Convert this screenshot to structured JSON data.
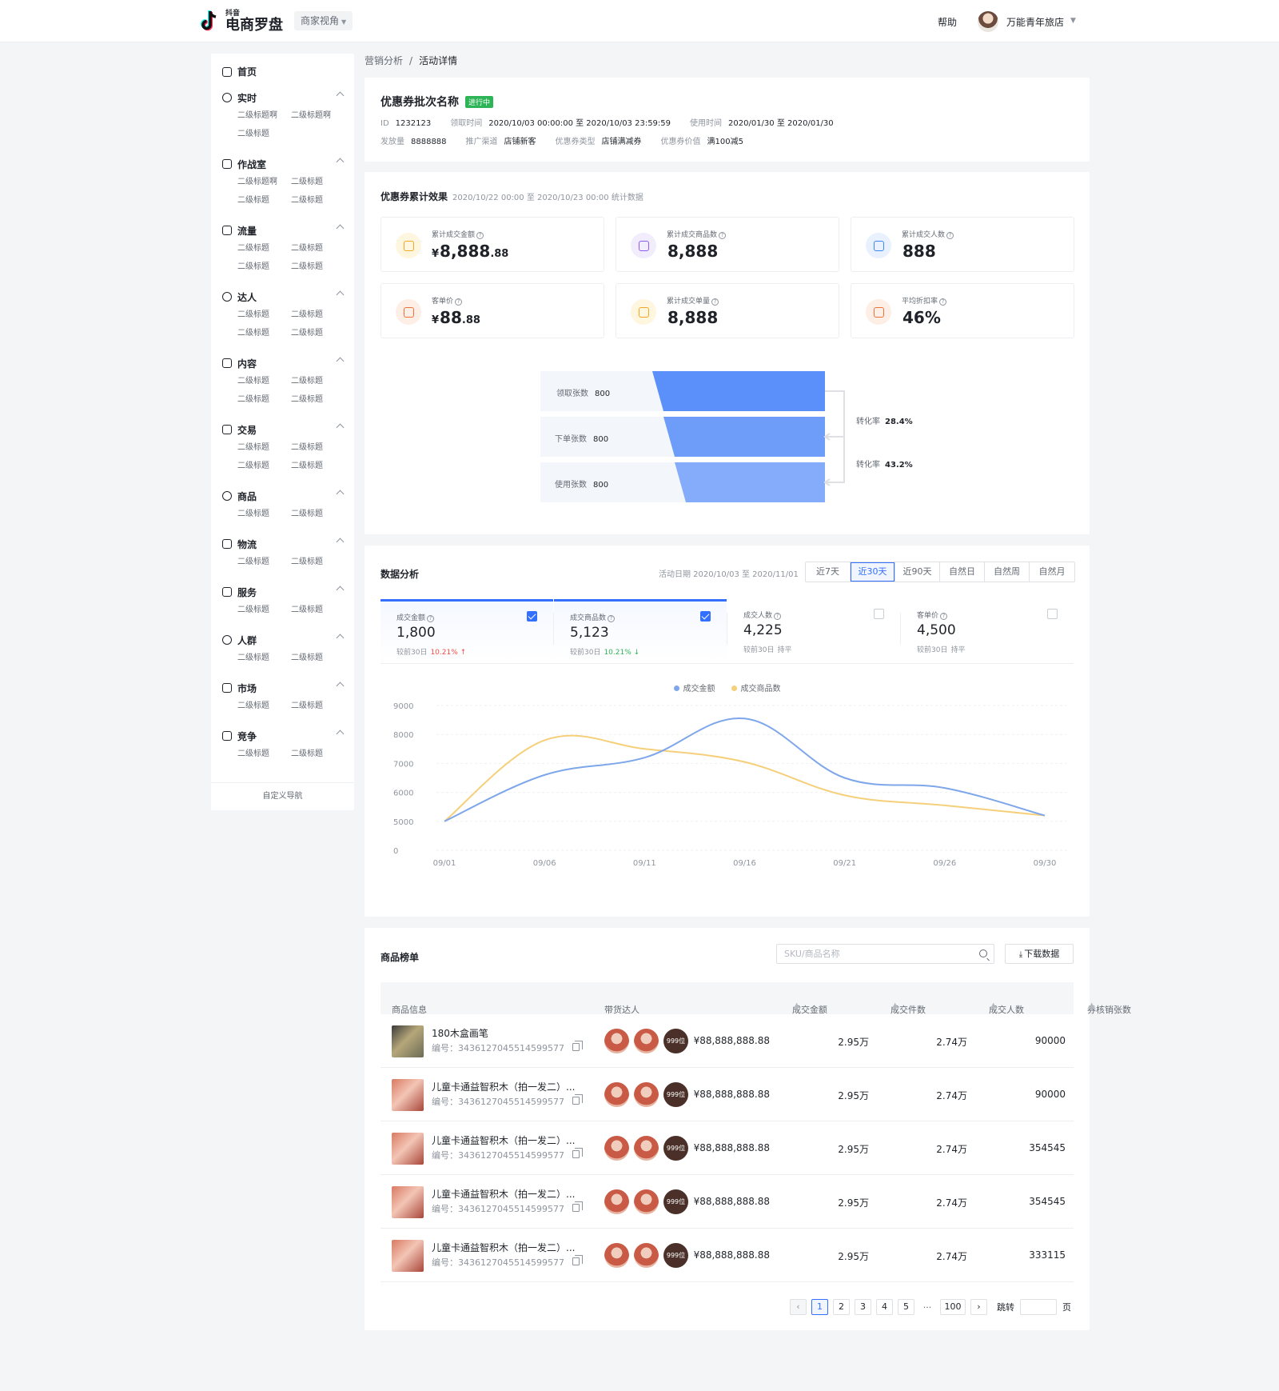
{
  "header": {
    "logo_small": "抖音",
    "logo_big": "电商罗盘",
    "view_switch": "商家视角",
    "help": "帮助",
    "shop_name": "万能青年旅店"
  },
  "sidebar": {
    "home": "首页",
    "groups": [
      {
        "title": "实时",
        "subs": [
          "二级标题啊",
          "二级标题啊",
          "二级标题"
        ]
      },
      {
        "title": "作战室",
        "subs": [
          "二级标题啊",
          "二级标题",
          "二级标题",
          "二级标题"
        ]
      },
      {
        "title": "流量",
        "subs": [
          "二级标题",
          "二级标题",
          "二级标题",
          "二级标题"
        ]
      },
      {
        "title": "达人",
        "subs": [
          "二级标题",
          "二级标题",
          "二级标题",
          "二级标题"
        ]
      },
      {
        "title": "内容",
        "subs": [
          "二级标题",
          "二级标题",
          "二级标题",
          "二级标题"
        ]
      },
      {
        "title": "交易",
        "subs": [
          "二级标题",
          "二级标题",
          "二级标题",
          "二级标题"
        ]
      },
      {
        "title": "商品",
        "subs": [
          "二级标题",
          "二级标题"
        ]
      },
      {
        "title": "物流",
        "subs": [
          "二级标题",
          "二级标题"
        ]
      },
      {
        "title": "服务",
        "subs": [
          "二级标题",
          "二级标题"
        ]
      },
      {
        "title": "人群",
        "subs": [
          "二级标题",
          "二级标题"
        ]
      },
      {
        "title": "市场",
        "subs": [
          "二级标题",
          "二级标题"
        ]
      },
      {
        "title": "竞争",
        "subs": [
          "二级标题",
          "二级标题"
        ]
      }
    ],
    "footer": "自定义导航"
  },
  "breadcrumb": {
    "parent": "营销分析",
    "separator": "/",
    "current": "活动详情"
  },
  "batch": {
    "title": "优惠券批次名称",
    "status": "进行中",
    "row1": [
      {
        "k": "ID",
        "v": "1232123"
      },
      {
        "k": "领取时间",
        "v": "2020/10/03   00:00:00 至 2020/10/03   23:59:59"
      },
      {
        "k": "使用时间",
        "v": "2020/01/30 至 2020/01/30"
      }
    ],
    "row2": [
      {
        "k": "发放量",
        "v": "8888888"
      },
      {
        "k": "推广渠道",
        "v": "店铺新客"
      },
      {
        "k": "优惠券类型",
        "v": "店铺满减券"
      },
      {
        "k": "优惠券价值",
        "v": "满100减5"
      }
    ]
  },
  "effect": {
    "title": "优惠券累计效果",
    "subtitle": "2020/10/22   00:00 至 2020/10/23   00:00 统计数据",
    "kpis": [
      {
        "label": "累计成交金额",
        "currency": "¥",
        "int": "8,888",
        "dec": ".88",
        "color": "#f5a623",
        "bg": "#fff6e0",
        "icon": "coin-icon"
      },
      {
        "label": "累计成交商品数",
        "currency": "",
        "int": "8,888",
        "dec": "",
        "color": "#8c5cf0",
        "bg": "#f2edfd",
        "icon": "bag-icon"
      },
      {
        "label": "累计成交人数",
        "currency": "",
        "int": "888",
        "dec": "",
        "color": "#3b86f7",
        "bg": "#e9f1fe",
        "icon": "bulb-icon"
      },
      {
        "label": "客单价",
        "currency": "¥",
        "int": "88",
        "dec": ".88",
        "color": "#f0703a",
        "bg": "#fdeee6",
        "icon": "receipt-icon"
      },
      {
        "label": "累计成交单量",
        "currency": "",
        "int": "8,888",
        "dec": "",
        "color": "#f5a623",
        "bg": "#fff6e0",
        "icon": "chart-box-icon"
      },
      {
        "label": "平均折扣率",
        "currency": "",
        "int": "46%",
        "dec": "",
        "color": "#f0703a",
        "bg": "#fdeee6",
        "icon": "ticket-icon"
      }
    ],
    "funnel": [
      {
        "label": "领取张数",
        "value": 800
      },
      {
        "label": "下单张数",
        "value": 800
      },
      {
        "label": "使用张数",
        "value": 800
      }
    ],
    "conversions": [
      {
        "label": "转化率",
        "value": "28.4%"
      },
      {
        "label": "转化率",
        "value": "43.2%"
      }
    ]
  },
  "analysis": {
    "title": "数据分析",
    "date_range": "活动日期 2020/10/03 至 2020/11/01",
    "ranges": [
      "近7天",
      "近30天",
      "近90天",
      "自然日",
      "自然周",
      "自然月"
    ],
    "active_range": 1,
    "metrics": [
      {
        "label": "成交金额",
        "value": "1,800",
        "cmp_label": "较前30日",
        "cmp": "10.21% ↑",
        "trend": "up",
        "checked": true
      },
      {
        "label": "成交商品数",
        "value": "5,123",
        "cmp_label": "较前30日",
        "cmp": "10.21% ↓",
        "trend": "down",
        "checked": true
      },
      {
        "label": "成交人数",
        "value": "4,225",
        "cmp_label": "较前30日",
        "cmp": "持平",
        "trend": "flat",
        "checked": false
      },
      {
        "label": "客单价",
        "value": "4,500",
        "cmp_label": "较前30日",
        "cmp": "持平",
        "trend": "flat",
        "checked": false
      }
    ]
  },
  "chart_data": {
    "type": "line",
    "x": [
      "09/01",
      "09/06",
      "09/11",
      "09/16",
      "09/21",
      "09/26",
      "09/30"
    ],
    "ylim": [
      0,
      9000
    ],
    "yticks": [
      0,
      5000,
      6000,
      7000,
      8000,
      9000
    ],
    "grid": true,
    "legend": "top-center",
    "series": [
      {
        "name": "成交金额",
        "color": "#7ea6ea",
        "values": [
          5000,
          6600,
          7200,
          8550,
          6500,
          6150,
          5200
        ]
      },
      {
        "name": "成交商品数",
        "color": "#f5cf7a",
        "values": [
          5000,
          7800,
          7500,
          7050,
          5900,
          5550,
          5200
        ]
      }
    ]
  },
  "products": {
    "title": "商品榜单",
    "search_placeholder": "SKU/商品名称",
    "download": "下载数据",
    "columns": [
      "商品信息",
      "带货达人",
      "成交金额",
      "成交件数",
      "成交人数",
      "券核销张数"
    ],
    "rows": [
      {
        "name": "180木盒画笔",
        "code": "编号：3436127045514599577",
        "more": "999位",
        "amount": "¥88,888,888.88",
        "qty": "2.95万",
        "buyers": "2.74万",
        "used": "90000"
      },
      {
        "name": "儿童卡通益智积木（拍一发二）...",
        "code": "编号：3436127045514599577",
        "more": "999位",
        "amount": "¥88,888,888.88",
        "qty": "2.95万",
        "buyers": "2.74万",
        "used": "90000"
      },
      {
        "name": "儿童卡通益智积木（拍一发二）...",
        "code": "编号：3436127045514599577",
        "more": "999位",
        "amount": "¥88,888,888.88",
        "qty": "2.95万",
        "buyers": "2.74万",
        "used": "354545"
      },
      {
        "name": "儿童卡通益智积木（拍一发二）...",
        "code": "编号：3436127045514599577",
        "more": "999位",
        "amount": "¥88,888,888.88",
        "qty": "2.95万",
        "buyers": "2.74万",
        "used": "354545"
      },
      {
        "name": "儿童卡通益智积木（拍一发二）...",
        "code": "编号：3436127045514599577",
        "more": "999位",
        "amount": "¥88,888,888.88",
        "qty": "2.95万",
        "buyers": "2.74万",
        "used": "333115"
      }
    ],
    "pager": {
      "pages": [
        "1",
        "2",
        "3",
        "4",
        "5"
      ],
      "current": "1",
      "dots": "···",
      "last": "100",
      "jump_label": "跳转",
      "page_unit": "页"
    }
  }
}
